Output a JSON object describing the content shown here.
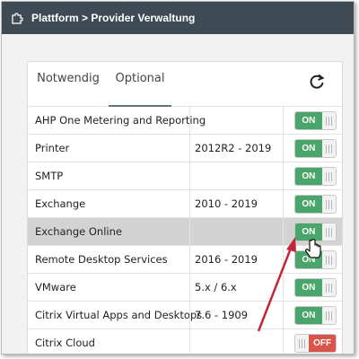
{
  "header": {
    "breadcrumb": "Plattform > Provider Verwaltung",
    "icon": "puzzle-icon"
  },
  "tabs": [
    {
      "label": "Notwendig",
      "active": false
    },
    {
      "label": "Optional",
      "active": true
    }
  ],
  "refresh_icon": "refresh-icon",
  "rows": [
    {
      "name": "AHP One Metering and Reporting",
      "version": "",
      "state": "ON",
      "selected": false
    },
    {
      "name": "Printer",
      "version": "2012R2 - 2019",
      "state": "ON",
      "selected": false
    },
    {
      "name": "SMTP",
      "version": "",
      "state": "ON",
      "selected": false
    },
    {
      "name": "Exchange",
      "version": "2010 - 2019",
      "state": "ON",
      "selected": false
    },
    {
      "name": "Exchange Online",
      "version": "",
      "state": "ON",
      "selected": true
    },
    {
      "name": "Remote Desktop Services",
      "version": "2016 - 2019",
      "state": "ON",
      "selected": false
    },
    {
      "name": "VMware",
      "version": "5.x / 6.x",
      "state": "ON",
      "selected": false
    },
    {
      "name": "Citrix Virtual Apps and Desktops",
      "version": "7.6 - 1909",
      "state": "ON",
      "selected": false
    },
    {
      "name": "Citrix Cloud",
      "version": "",
      "state": "OFF",
      "selected": false
    }
  ],
  "colors": {
    "topbar": "#3f4b54",
    "on": "#4aa56a",
    "off": "#d9554b",
    "arrow": "#c0283a"
  }
}
